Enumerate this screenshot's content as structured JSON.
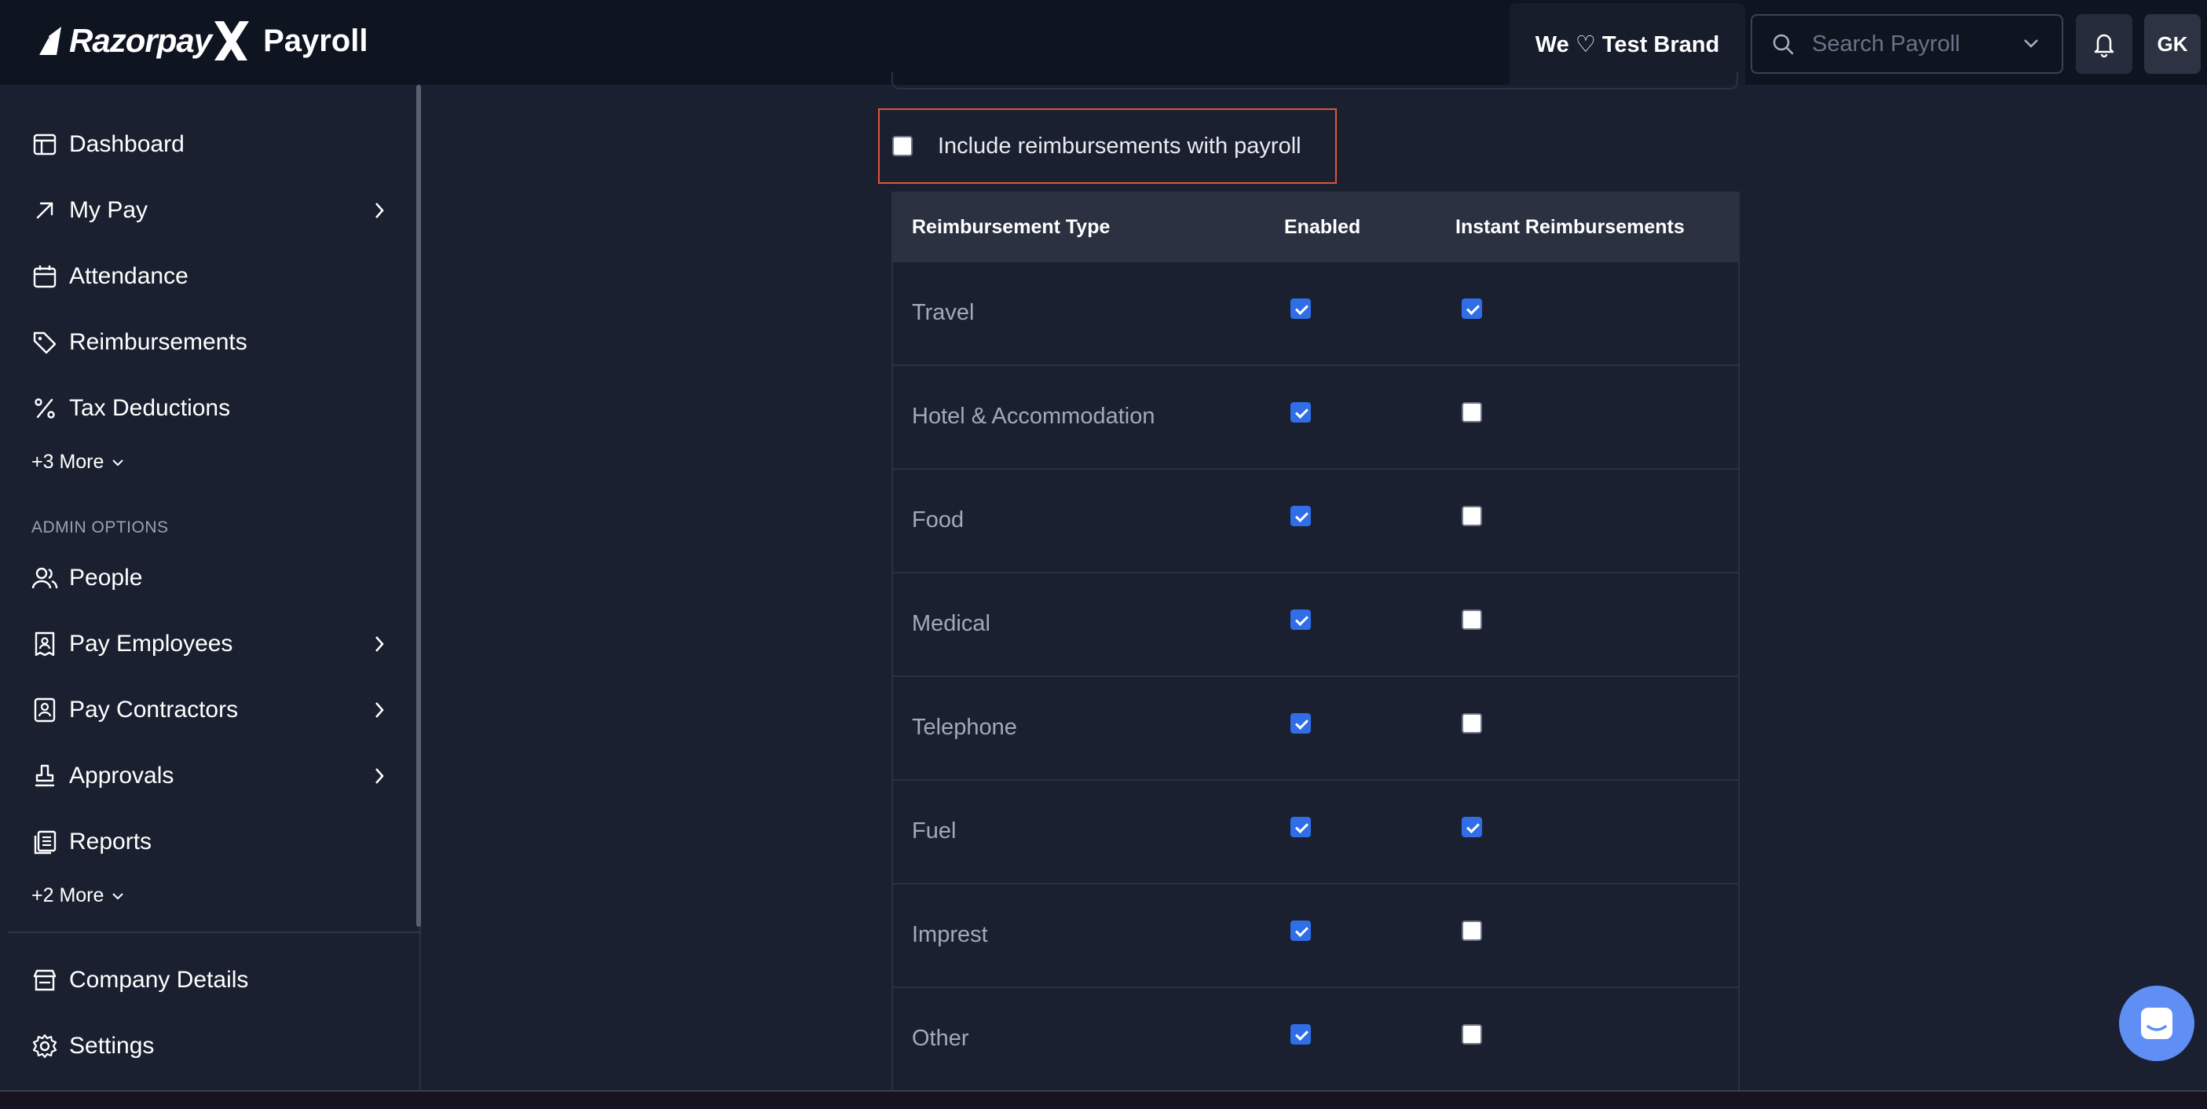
{
  "header": {
    "brand_name": "RazorpayX",
    "brand_name_main": "Razorpay",
    "product_name": "Payroll",
    "company_chip": "We ♡ Test Brand",
    "search_placeholder": "Search Payroll",
    "avatar_initials": "GK"
  },
  "sidebar": {
    "items": [
      {
        "label": "Dashboard",
        "icon": "dashboard-icon"
      },
      {
        "label": "My Pay",
        "icon": "arrow-up-right-icon",
        "has_submenu": true
      },
      {
        "label": "Attendance",
        "icon": "calendar-icon"
      },
      {
        "label": "Reimbursements",
        "icon": "tag-icon"
      },
      {
        "label": "Tax Deductions",
        "icon": "percent-icon"
      }
    ],
    "more_1": "+3 More",
    "admin_label": "ADMIN OPTIONS",
    "admin_items": [
      {
        "label": "People",
        "icon": "people-icon"
      },
      {
        "label": "Pay Employees",
        "icon": "receipt-icon",
        "has_submenu": true
      },
      {
        "label": "Pay Contractors",
        "icon": "contractor-icon",
        "has_submenu": true
      },
      {
        "label": "Approvals",
        "icon": "stamp-icon",
        "has_submenu": true
      },
      {
        "label": "Reports",
        "icon": "reports-icon"
      }
    ],
    "more_2": "+2 More",
    "bottom_items": [
      {
        "label": "Company Details",
        "icon": "store-icon"
      },
      {
        "label": "Settings",
        "icon": "gear-icon"
      }
    ]
  },
  "main": {
    "include_label": "Include reimbursements with payroll",
    "include_checked": false,
    "table": {
      "headers": [
        "Reimbursement Type",
        "Enabled",
        "Instant Reimbursements"
      ],
      "rows": [
        {
          "type": "Travel",
          "enabled": true,
          "instant": true
        },
        {
          "type": "Hotel & Accommodation",
          "enabled": true,
          "instant": false
        },
        {
          "type": "Food",
          "enabled": true,
          "instant": false
        },
        {
          "type": "Medical",
          "enabled": true,
          "instant": false
        },
        {
          "type": "Telephone",
          "enabled": true,
          "instant": false
        },
        {
          "type": "Fuel",
          "enabled": true,
          "instant": true
        },
        {
          "type": "Imprest",
          "enabled": true,
          "instant": false
        },
        {
          "type": "Other",
          "enabled": true,
          "instant": false
        }
      ]
    }
  },
  "colors": {
    "background": "#1b2030",
    "topbar": "#0e1420",
    "checkbox_checked": "#2f6ee6",
    "highlight_border": "#e0533d",
    "chat_bubble": "#5f8ff5"
  }
}
